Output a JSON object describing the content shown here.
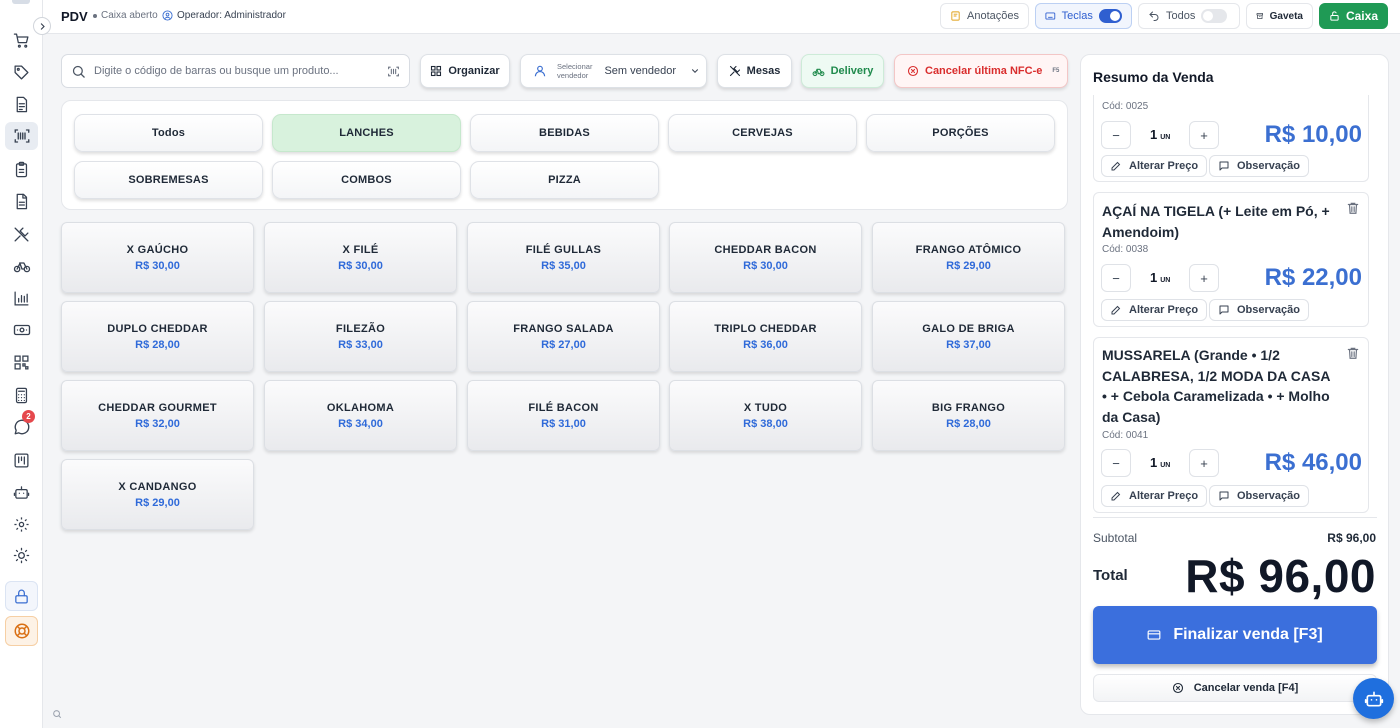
{
  "header": {
    "title": "PDV",
    "register_status": "Caixa aberto",
    "operator": "Operador: Administrador",
    "buttons": {
      "notes": "Anotações",
      "keys": "Teclas",
      "all": "Todos",
      "drawer": "Gaveta",
      "cash": "Caixa"
    },
    "keys_toggle_on": true,
    "all_toggle_on": false
  },
  "sidebar": {
    "icons": [
      "cart-icon",
      "tag-icon",
      "document-icon",
      "barcode-icon",
      "clipboard-icon",
      "file-icon",
      "utensils-icon",
      "bicycle-icon",
      "bar-chart-icon",
      "cash-icon",
      "qr-code-icon",
      "calculator-icon",
      "chat-icon",
      "kanban-icon",
      "robot-icon",
      "gear-icon",
      "sun-icon",
      "lock-icon",
      "lifebuoy-icon"
    ],
    "chat_badge": "2"
  },
  "toolbar": {
    "search_placeholder": "Digite o código de barras ou busque um produto...",
    "organize": "Organizar",
    "seller_label_line1": "Selecionar",
    "seller_label_line2": "vendedor",
    "seller_value": "Sem vendedor",
    "tables": "Mesas",
    "delivery": "Delivery",
    "cancel_nfce": "Cancelar última NFC-e",
    "cancel_nfce_key": "F5"
  },
  "categories": [
    "Todos",
    "LANCHES",
    "BEBIDAS",
    "CERVEJAS",
    "PORÇÕES",
    "SOBREMESAS",
    "COMBOS",
    "PIZZA"
  ],
  "active_category": "LANCHES",
  "products": [
    {
      "name": "X GAÚCHO",
      "price": "R$ 30,00"
    },
    {
      "name": "X FILÉ",
      "price": "R$ 30,00"
    },
    {
      "name": "FILÉ GULLAS",
      "price": "R$ 35,00"
    },
    {
      "name": "CHEDDAR BACON",
      "price": "R$ 30,00"
    },
    {
      "name": "FRANGO ATÔMICO",
      "price": "R$ 29,00"
    },
    {
      "name": "DUPLO CHEDDAR",
      "price": "R$ 28,00"
    },
    {
      "name": "FILEZÃO",
      "price": "R$ 33,00"
    },
    {
      "name": "FRANGO SALADA",
      "price": "R$ 27,00"
    },
    {
      "name": "TRIPLO CHEDDAR",
      "price": "R$ 36,00"
    },
    {
      "name": "GALO DE BRIGA",
      "price": "R$ 37,00"
    },
    {
      "name": "CHEDDAR GOURMET",
      "price": "R$ 32,00"
    },
    {
      "name": "OKLAHOMA",
      "price": "R$ 34,00"
    },
    {
      "name": "FILÉ BACON",
      "price": "R$ 31,00"
    },
    {
      "name": "X TUDO",
      "price": "R$ 38,00"
    },
    {
      "name": "BIG FRANGO",
      "price": "R$ 28,00"
    },
    {
      "name": "X CANDANGO",
      "price": "R$ 29,00"
    }
  ],
  "sale": {
    "title": "Resumo da Venda",
    "items": [
      {
        "name": "",
        "code": "Cód: 0025",
        "qty": "1",
        "unit": "UN",
        "price": "R$ 10,00"
      },
      {
        "name": "AÇAÍ NA TIGELA (+ Leite em Pó, + Amendoim)",
        "code": "Cód: 0038",
        "qty": "1",
        "unit": "UN",
        "price": "R$ 22,00"
      },
      {
        "name": "MUSSARELA (Grande • 1/2 CALABRESA, 1/2 MODA DA CASA • + Cebola Caramelizada • + Molho da Casa)",
        "code": "Cód: 0041",
        "qty": "1",
        "unit": "UN",
        "price": "R$ 46,00"
      }
    ],
    "change_price": "Alterar Preço",
    "note": "Observação",
    "subtotal_label": "Subtotal",
    "subtotal_value": "R$ 96,00",
    "total_label": "Total",
    "total_value": "R$ 96,00",
    "finalize": "Finalizar venda [F3]",
    "cancel": "Cancelar venda [F4]"
  },
  "colors": {
    "accent": "#3b6fdd",
    "price": "#2f6ad9",
    "active_category": "#d8f2dd",
    "cash_button": "#1f9a55",
    "danger": "#d92d2d"
  }
}
